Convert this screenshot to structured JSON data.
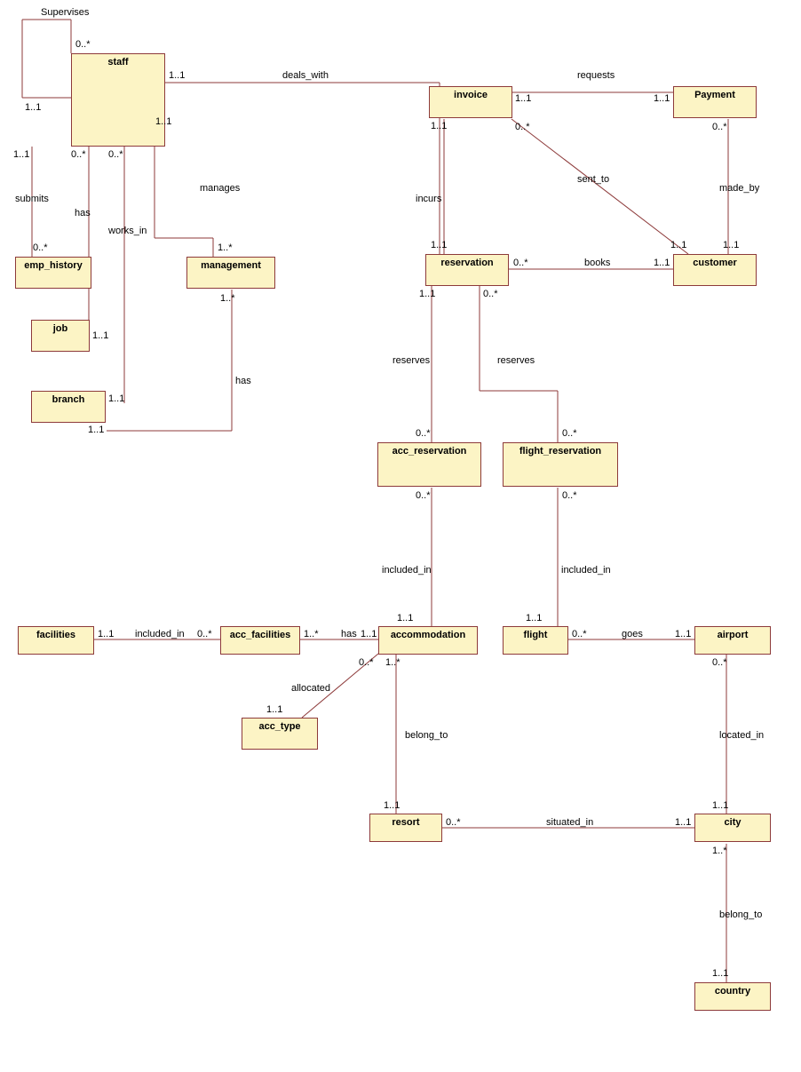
{
  "entities": {
    "staff": "staff",
    "emp_history": "emp_history",
    "job": "job",
    "branch": "branch",
    "management": "management",
    "invoice": "invoice",
    "payment": "Payment",
    "reservation": "reservation",
    "customer": "customer",
    "acc_reservation": "acc_reservation",
    "flight_reservation": "flight_reservation",
    "facilities": "facilities",
    "acc_facilities": "acc_facilities",
    "accommodation": "accommodation",
    "flight": "flight",
    "airport": "airport",
    "acc_type": "acc_type",
    "resort": "resort",
    "city": "city",
    "country": "country"
  },
  "labels": {
    "supervises": "Supervises",
    "deals_with": "deals_with",
    "requests": "requests",
    "submits": "submits",
    "has1": "has",
    "works_in": "works_in",
    "manages": "manages",
    "sent_to": "sent_to",
    "made_by": "made_by",
    "incurs": "incurs",
    "books": "books",
    "has2": "has",
    "reserves1": "reserves",
    "reserves2": "reserves",
    "included_in1": "included_in",
    "included_in2": "included_in",
    "included_in3": "included_in",
    "has3": "has",
    "goes": "goes",
    "allocated": "allocated",
    "belong_to1": "belong_to",
    "located_in": "located_in",
    "situated_in": "situated_in",
    "belong_to2": "belong_to"
  },
  "mult": {
    "m0star": "0..*",
    "m11": "1..1",
    "m1star": "1..*"
  }
}
